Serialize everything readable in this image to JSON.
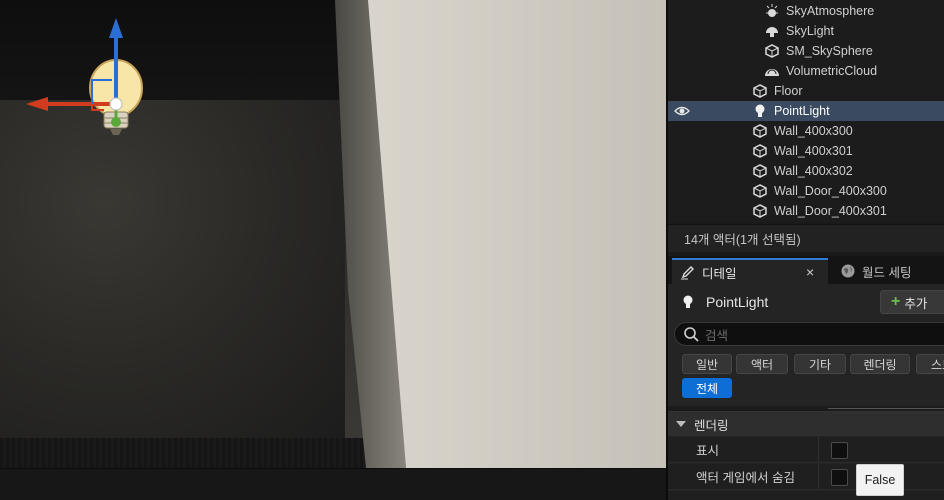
{
  "outliner": {
    "items": [
      {
        "label": "SkyAtmosphere",
        "icon": "sky-atmosphere-icon"
      },
      {
        "label": "SkyLight",
        "icon": "sky-light-icon"
      },
      {
        "label": "SM_SkySphere",
        "icon": "static-mesh-icon"
      },
      {
        "label": "VolumetricCloud",
        "icon": "volumetric-cloud-icon"
      },
      {
        "label": "Floor",
        "icon": "static-mesh-icon"
      },
      {
        "label": "PointLight",
        "icon": "point-light-icon",
        "selected": true
      },
      {
        "label": "Wall_400x300",
        "icon": "static-mesh-icon"
      },
      {
        "label": "Wall_400x301",
        "icon": "static-mesh-icon"
      },
      {
        "label": "Wall_400x302",
        "icon": "static-mesh-icon"
      },
      {
        "label": "Wall_Door_400x300",
        "icon": "static-mesh-icon"
      },
      {
        "label": "Wall_Door_400x301",
        "icon": "static-mesh-icon"
      }
    ],
    "status": "14개 액터(1개 선택됨)"
  },
  "tabs": {
    "details": "디테일",
    "world_settings": "월드 세팅"
  },
  "details": {
    "actor_name": "PointLight",
    "add_label": "추가",
    "search_placeholder": "검색",
    "filters": [
      "일반",
      "액터",
      "기타",
      "렌더링",
      "스트",
      "전체"
    ],
    "section_title": "렌더링",
    "properties": [
      {
        "label": "표시",
        "checked": false
      },
      {
        "label": "액터 게임에서 숨김",
        "checked": false
      }
    ]
  },
  "tooltip": {
    "text": "False"
  },
  "colors": {
    "accent": "#0d6fd6",
    "selection": "#3a4a60",
    "gizmo_x": "#d23c1e",
    "gizmo_z": "#2b6fd6",
    "gizmo_y": "#5aa83a"
  }
}
